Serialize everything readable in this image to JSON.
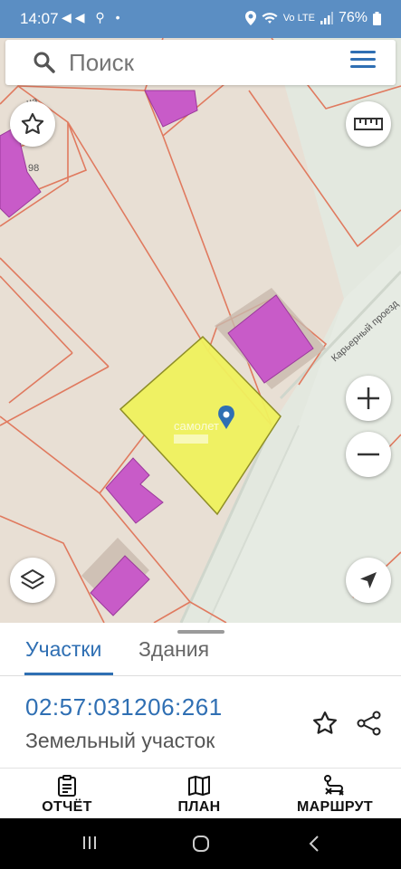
{
  "status_bar": {
    "time": "14:07",
    "notifications": "◀◀ ⚲ •",
    "battery": "76%",
    "system_icons": "Vo LTE"
  },
  "search": {
    "placeholder": "Поиск"
  },
  "map": {
    "house_number": "98",
    "street_label": "Карьерный проезд",
    "street_label_top": "ца",
    "watermark": "самолет",
    "parcel_fill": "#f0f25e",
    "building_fill": "#c85bc8",
    "boundary_color": "#e07a5f",
    "marker_color": "#2f6fb3"
  },
  "sheet": {
    "tabs": [
      {
        "label": "Участки",
        "active": true
      },
      {
        "label": "Здания",
        "active": false
      }
    ],
    "cadastral_number": "02:57:031206:261",
    "parcel_type": "Земельный участок"
  },
  "bottom_nav": {
    "items": [
      {
        "label": "ОТЧЁТ",
        "icon": "clipboard-icon"
      },
      {
        "label": "ПЛАН",
        "icon": "map-icon"
      },
      {
        "label": "МАРШРУТ",
        "icon": "route-icon"
      }
    ]
  },
  "colors": {
    "accent": "#2f6fb3",
    "status_bar": "#5b8ec3"
  }
}
